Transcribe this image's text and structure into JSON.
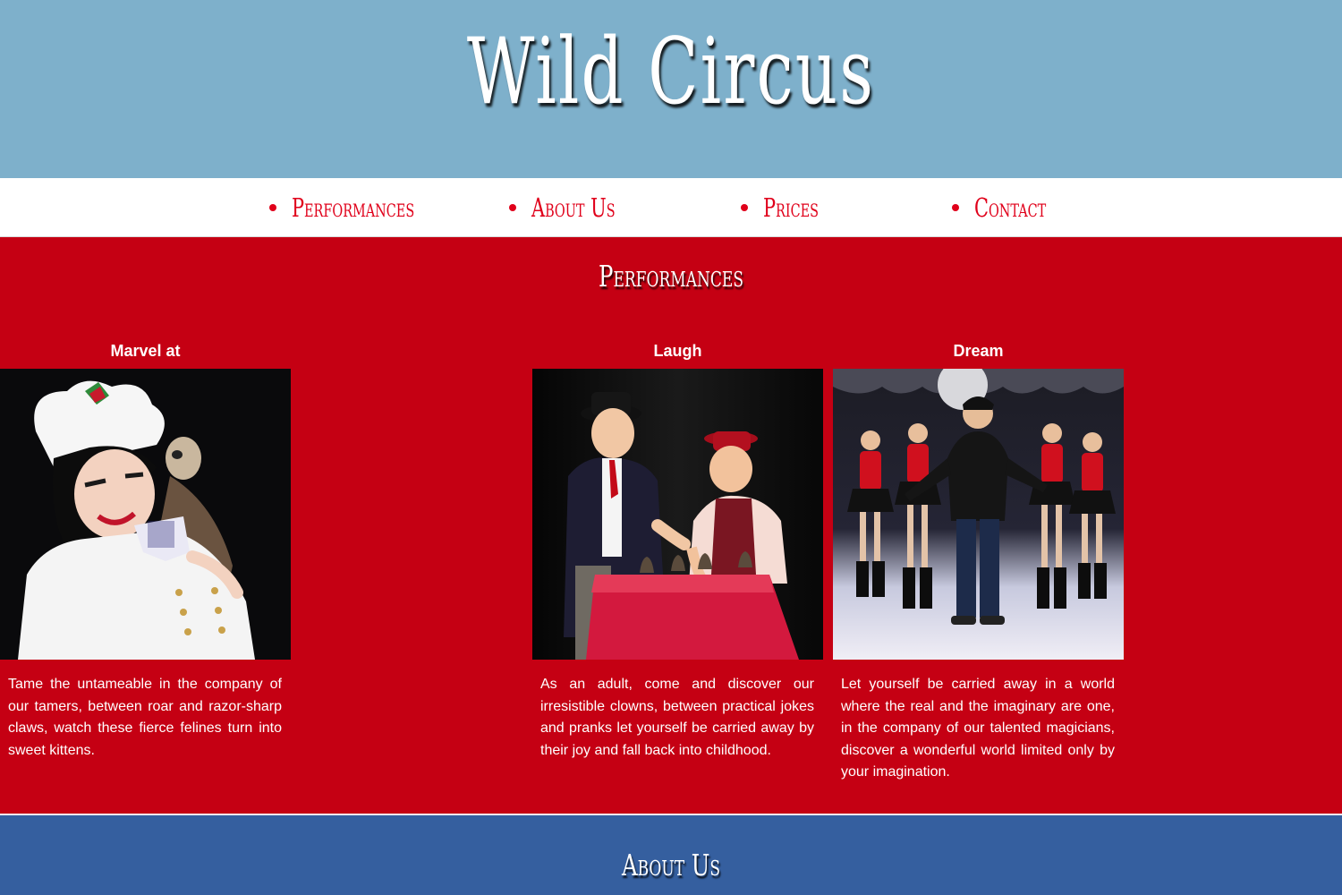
{
  "header": {
    "title": "Wild Circus"
  },
  "nav": {
    "items": [
      {
        "label": "Performances"
      },
      {
        "label": "About Us"
      },
      {
        "label": "Prices"
      },
      {
        "label": "Contact"
      }
    ]
  },
  "performances": {
    "title": "Performances",
    "cards": [
      {
        "heading": "Laugh",
        "photo": "clowns-photo",
        "text": "As an adult, come and discover our irresistible clowns, between practical jokes and pranks let yourself be carried away by their joy and fall back into childhood."
      },
      {
        "heading": "Dream",
        "photo": "magician-dancers-photo",
        "text": "Let yourself be carried away in a world where the real and the imaginary are one, in the company of our talented magicians, discover a wonderful world limited only by your imagination."
      },
      {
        "heading": "Marvel at",
        "photo": "tamer-ferret-photo",
        "text": "Tame the untameable in the company of our tamers, between roar and razor-sharp claws, watch these fierce felines turn into sweet kittens."
      }
    ]
  },
  "about": {
    "title": "About Us"
  },
  "colors": {
    "header_bg": "#7eb0cb",
    "accent_red": "#e0001a",
    "section_red": "#c50013",
    "about_blue": "#355f9f"
  }
}
